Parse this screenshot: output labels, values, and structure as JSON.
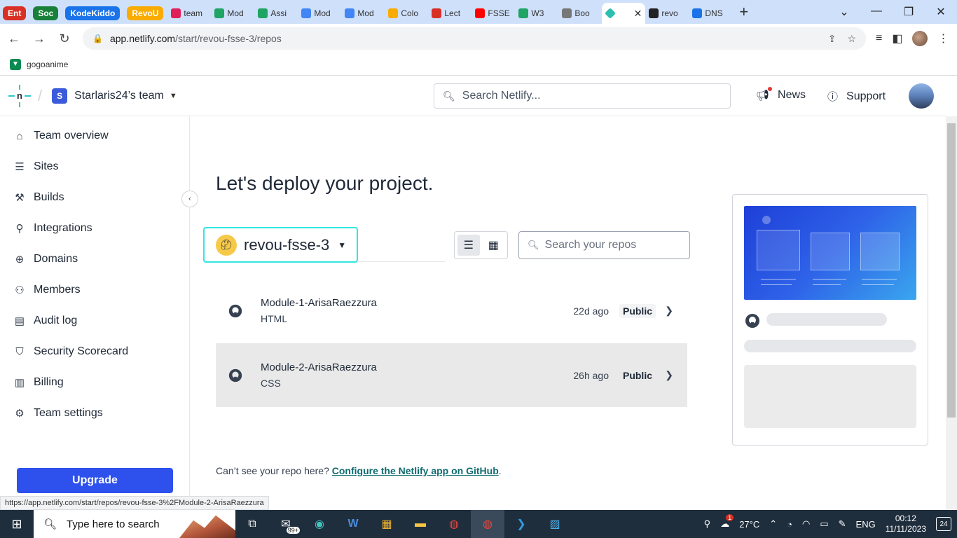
{
  "browser": {
    "tab_groups": [
      {
        "label": "Ent",
        "color": "#d93025"
      },
      {
        "label": "Soc",
        "color": "#188038"
      },
      {
        "label": "KodeKiddo",
        "color": "#1a73e8"
      },
      {
        "label": "RevoU",
        "color": "#f9ab00"
      }
    ],
    "tabs": [
      {
        "label": "team",
        "icon": "slack-icon",
        "color": "#e01e5a"
      },
      {
        "label": "Mod",
        "icon": "drive-icon",
        "color": "#1fa463"
      },
      {
        "label": "Assi",
        "icon": "drive-icon",
        "color": "#1fa463"
      },
      {
        "label": "Mod",
        "icon": "docs-icon",
        "color": "#4285f4"
      },
      {
        "label": "Mod",
        "icon": "docs-icon",
        "color": "#4285f4"
      },
      {
        "label": "Colo",
        "icon": "colab-icon",
        "color": "#f9ab00"
      },
      {
        "label": "Lect",
        "icon": "record-icon",
        "color": "#d93025"
      },
      {
        "label": "FSSE",
        "icon": "youtube-icon",
        "color": "#ff0000"
      },
      {
        "label": "W3",
        "icon": "drive-icon",
        "color": "#1fa463"
      },
      {
        "label": "Boo",
        "icon": "globe-icon",
        "color": "#777777"
      }
    ],
    "active_tab_icon_color": "#2bbfb0",
    "tabs_after": [
      {
        "label": "revo",
        "icon": "github-icon",
        "color": "#222222"
      },
      {
        "label": "DNS",
        "icon": "dns-icon",
        "color": "#1a73e8"
      }
    ],
    "url_host": "app.netlify.com",
    "url_path": "/start/revou-fsse-3/repos",
    "bookmark": "gogoanime",
    "status_url": "https://app.netlify.com/start/repos/revou-fsse-3%2FModule-2-ArisaRaezzura"
  },
  "header": {
    "team_initial": "S",
    "team_name": "Starlaris24’s team",
    "search_placeholder": "Search Netlify...",
    "news": "News",
    "support": "Support"
  },
  "sidebar": {
    "items": [
      {
        "label": "Team overview",
        "icon": "home-icon",
        "glyph": "⌂"
      },
      {
        "label": "Sites",
        "icon": "sites-icon",
        "glyph": "☰"
      },
      {
        "label": "Builds",
        "icon": "builds-icon",
        "glyph": "⚒"
      },
      {
        "label": "Integrations",
        "icon": "plug-icon",
        "glyph": "⚲"
      },
      {
        "label": "Domains",
        "icon": "globe-icon",
        "glyph": "⊕"
      },
      {
        "label": "Members",
        "icon": "members-icon",
        "glyph": "⚇"
      },
      {
        "label": "Audit log",
        "icon": "audit-log-icon",
        "glyph": "▤"
      },
      {
        "label": "Security Scorecard",
        "icon": "shield-icon",
        "glyph": "⛉"
      },
      {
        "label": "Billing",
        "icon": "billing-icon",
        "glyph": "▥"
      },
      {
        "label": "Team settings",
        "icon": "gear-icon",
        "glyph": "⚙"
      }
    ],
    "upgrade": "Upgrade"
  },
  "main": {
    "title": "Let's deploy your project.",
    "owner": "revou-fsse-3",
    "repo_search_placeholder": "Search your repos",
    "repos": [
      {
        "name": "Module-1-ArisaRaezzura",
        "lang": "HTML",
        "time": "22d ago",
        "visibility": "Public"
      },
      {
        "name": "Module-2-ArisaRaezzura",
        "lang": "CSS",
        "time": "26h ago",
        "visibility": "Public"
      }
    ],
    "help_text": "Can’t see your repo here?",
    "help_link": "Configure the Netlify app on GitHub",
    "help_end": "."
  },
  "taskbar": {
    "search": "Type here to search",
    "mail_badge": "99+",
    "weather_badge": "1",
    "temperature": "27°C",
    "lang": "ENG",
    "time": "00:12",
    "date": "11/11/2023",
    "notifications": "24"
  },
  "colors": {
    "accent": "#2e51ed",
    "teal": "#32e6e2",
    "link": "#0d6b6e"
  }
}
